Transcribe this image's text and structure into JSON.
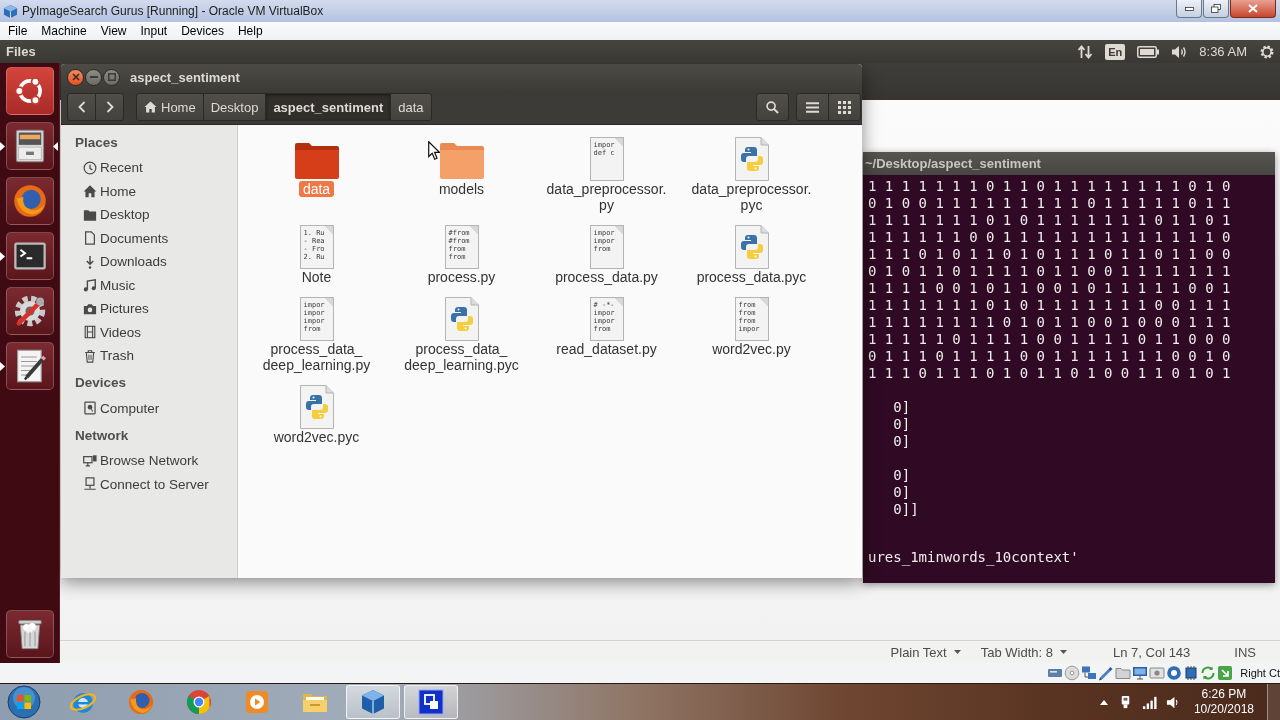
{
  "host_window": {
    "title": "PyImageSearch Gurus [Running] - Oracle VM VirtualBox",
    "menu": [
      "File",
      "Machine",
      "View",
      "Input",
      "Devices",
      "Help"
    ]
  },
  "top_panel": {
    "app_name": "Files",
    "keyboard_layout": "En",
    "clock": "8:36 AM"
  },
  "launcher": [
    {
      "kind": "dash",
      "running": false,
      "focused": false
    },
    {
      "kind": "files",
      "running": true,
      "focused": true
    },
    {
      "kind": "browser",
      "running": false,
      "focused": false
    },
    {
      "kind": "terminal",
      "running": true,
      "focused": false
    },
    {
      "kind": "settings",
      "running": false,
      "focused": false
    },
    {
      "kind": "text_editor",
      "running": true,
      "focused": false
    },
    {
      "kind": "trash",
      "running": false,
      "focused": false
    }
  ],
  "file_manager": {
    "title": "aspect_sentiment",
    "path": [
      {
        "label": "Home",
        "kind": "home",
        "selected": false
      },
      {
        "label": "Desktop",
        "kind": "folder",
        "selected": false
      },
      {
        "label": "aspect_sentiment",
        "kind": "folder",
        "selected": true
      },
      {
        "label": "data",
        "kind": "folder",
        "selected": false
      }
    ],
    "sidebar": [
      {
        "heading": "Places",
        "items": [
          {
            "label": "Recent",
            "kind": "recent",
            "selected": false
          },
          {
            "label": "Home",
            "kind": "home",
            "selected": false
          },
          {
            "label": "Desktop",
            "kind": "desktop",
            "selected": false
          },
          {
            "label": "Documents",
            "kind": "documents",
            "selected": false
          },
          {
            "label": "Downloads",
            "kind": "downloads",
            "selected": false
          },
          {
            "label": "Music",
            "kind": "music",
            "selected": false
          },
          {
            "label": "Pictures",
            "kind": "pictures",
            "selected": false
          },
          {
            "label": "Videos",
            "kind": "videos",
            "selected": false
          },
          {
            "label": "Trash",
            "kind": "trash",
            "selected": false
          }
        ]
      },
      {
        "heading": "Devices",
        "items": [
          {
            "label": "Computer",
            "kind": "computer",
            "selected": false
          }
        ]
      },
      {
        "heading": "Network",
        "items": [
          {
            "label": "Browse Network",
            "kind": "network",
            "selected": false
          },
          {
            "label": "Connect to Server",
            "kind": "server",
            "selected": false
          }
        ]
      }
    ],
    "files": [
      {
        "name": "data",
        "kind": "folder",
        "selected": true,
        "hovered": false
      },
      {
        "name": "models",
        "kind": "folder",
        "selected": false,
        "hovered": true
      },
      {
        "name": "data_preprocessor.py",
        "kind": "text",
        "preview": [
          "impor",
          "def c"
        ],
        "selected": false,
        "hovered": false
      },
      {
        "name": "data_preprocessor.pyc",
        "kind": "python",
        "selected": false,
        "hovered": false
      },
      {
        "name": "Note",
        "kind": "text",
        "preview": [
          "1. Ru",
          "- Rea",
          "- Fro",
          "2. Ru"
        ],
        "selected": false,
        "hovered": false
      },
      {
        "name": "process.py",
        "kind": "text",
        "preview": [
          "#from",
          "#from",
          "from",
          "from"
        ],
        "selected": false,
        "hovered": false
      },
      {
        "name": "process_data.py",
        "kind": "text",
        "preview": [
          "impor",
          "impor",
          "from"
        ],
        "selected": false,
        "hovered": false
      },
      {
        "name": "process_data.pyc",
        "kind": "python",
        "selected": false,
        "hovered": false
      },
      {
        "name": "process_data_deep_learning.py",
        "kind": "text",
        "preview": [
          "impor",
          "impor",
          "impor",
          "from"
        ],
        "selected": false,
        "hovered": false
      },
      {
        "name": "process_data_deep_learning.pyc",
        "kind": "python",
        "selected": false,
        "hovered": false
      },
      {
        "name": "read_dataset.py",
        "kind": "text",
        "preview": [
          "# -*-",
          "impor",
          "impor",
          "from"
        ],
        "selected": false,
        "hovered": false
      },
      {
        "name": "word2vec.py",
        "kind": "text",
        "preview": [
          "from",
          "from",
          "from",
          "impor"
        ],
        "selected": false,
        "hovered": false
      },
      {
        "name": "word2vec.pyc",
        "kind": "python",
        "selected": false,
        "hovered": false
      }
    ]
  },
  "terminal": {
    "title": "~/Desktop/aspect_sentiment",
    "blocks": [
      {
        "kind": "plain",
        "lines": [
          "1 1 1 1 1 1 1 0 1 1 0 1 1 1 1 1 1 1 1 0 1 0",
          "0 1 0 0 1 1 1 1 1 1 1 1 1 0 1 1 1 1 1 0 1 1",
          "1 1 1 1 1 1 1 0 1 0 1 1 1 1 1 1 1 0 1 1 0 1",
          "1 1 1 1 1 1 0 0 1 1 1 1 1 1 1 1 1 1 1 1 1 0",
          "1 1 1 0 1 0 1 1 0 1 0 1 1 1 0 1 1 0 1 1 0 0",
          "0 1 0 1 1 0 1 1 1 1 0 1 1 0 0 1 1 1 1 1 1 1",
          "1 1 1 1 0 0 1 0 1 1 0 0 1 0 1 1 1 1 1 0 0 1",
          "1 1 1 1 1 1 1 0 1 0 1 1 1 1 1 1 1 0 0 1 1 1",
          "1 1 1 1 1 1 1 1 0 1 0 1 1 0 0 1 0 0 0 1 1 1",
          "1 1 1 1 1 0 1 1 1 1 0 0 1 1 1 1 0 1 1 0 0 0",
          "0 1 1 1 0 1 1 1 1 0 0 1 1 1 1 1 1 1 0 0 1 0",
          "1 1 1 0 1 1 1 0 1 0 1 1 0 1 0 0 1 1 0 1 0 1"
        ]
      },
      {
        "kind": "indented",
        "lines": [
          "0]",
          "0]",
          "0]"
        ]
      },
      {
        "kind": "indented",
        "lines": [
          "0]",
          "0]",
          "0]]"
        ]
      },
      {
        "kind": "plain",
        "lines": [
          "ures_1minwords_10context'"
        ]
      }
    ]
  },
  "editor_status_bar": {
    "language": "Plain Text",
    "tab_width": "Tab Width: 8",
    "cursor_position": "Ln 7, Col 143",
    "insert_mode": "INS"
  },
  "vm_status_bar": {
    "host_key": "Right Ct"
  },
  "taskbar": {
    "apps": [
      {
        "kind": "internet_explorer",
        "active": false
      },
      {
        "kind": "firefox",
        "active": false
      },
      {
        "kind": "chrome",
        "active": false
      },
      {
        "kind": "media_player",
        "active": false
      },
      {
        "kind": "file_explorer",
        "active": false
      },
      {
        "kind": "virtualbox",
        "active": true
      },
      {
        "kind": "remote_app",
        "active": true
      }
    ],
    "clock_time": "6:26 PM",
    "clock_date": "10/20/2018"
  }
}
